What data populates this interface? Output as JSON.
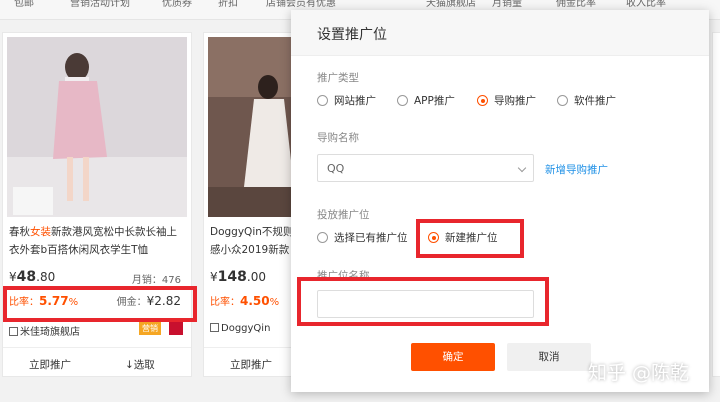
{
  "topbar": {
    "filters": [
      "包邮",
      "营销活动计划",
      "优质券",
      "折扣",
      "店铺会员有优惠",
      "天猫旗舰店",
      "月销量",
      "佣金比率",
      "收入比率"
    ]
  },
  "cards": [
    {
      "title_pre": "春秋",
      "title_hl": "女装",
      "title_post": "新款港风宽松中长款长袖上衣外套b百搭休闲风衣学生T恤",
      "price_symbol": "¥",
      "price_int": "48",
      "price_dec": ".80",
      "sales": "月销：476",
      "rate_label": "比率：",
      "rate_value": "5.77",
      "rate_unit": "%",
      "comm_label": "佣金：",
      "comm_value": "¥2.82",
      "shop": "米佳琦旗舰店",
      "badge": "营销",
      "action_promote": "立即推广",
      "action_select": "↓选取"
    },
    {
      "title_pre": "DoggyQin不规则",
      "title_hl": "",
      "title_post": "感小众2019新款",
      "price_symbol": "¥",
      "price_int": "148",
      "price_dec": ".00",
      "rate_label": "比率：",
      "rate_value": "4.50",
      "rate_unit": "%",
      "shop": "DoggyQin",
      "action_promote": "立即推广"
    }
  ],
  "modal": {
    "title": "设置推广位",
    "promo_type_label": "推广类型",
    "promo_types": [
      "网站推广",
      "APP推广",
      "导购推广",
      "软件推广"
    ],
    "selected_type": "导购推广",
    "guide_name_label": "导购名称",
    "guide_select_value": "QQ",
    "new_guide_link": "新增导购推广",
    "placement_label": "投放推广位",
    "placement_options": [
      "选择已有推广位",
      "新建推广位"
    ],
    "selected_placement": "新建推广位",
    "name_label": "推广位名称",
    "name_value": "",
    "confirm": "确定",
    "cancel": "取消"
  },
  "watermark": "知乎 @陈乾",
  "colors": {
    "accent": "#ff5000",
    "highlight_box": "#e8262d",
    "link": "#1e90e6"
  }
}
